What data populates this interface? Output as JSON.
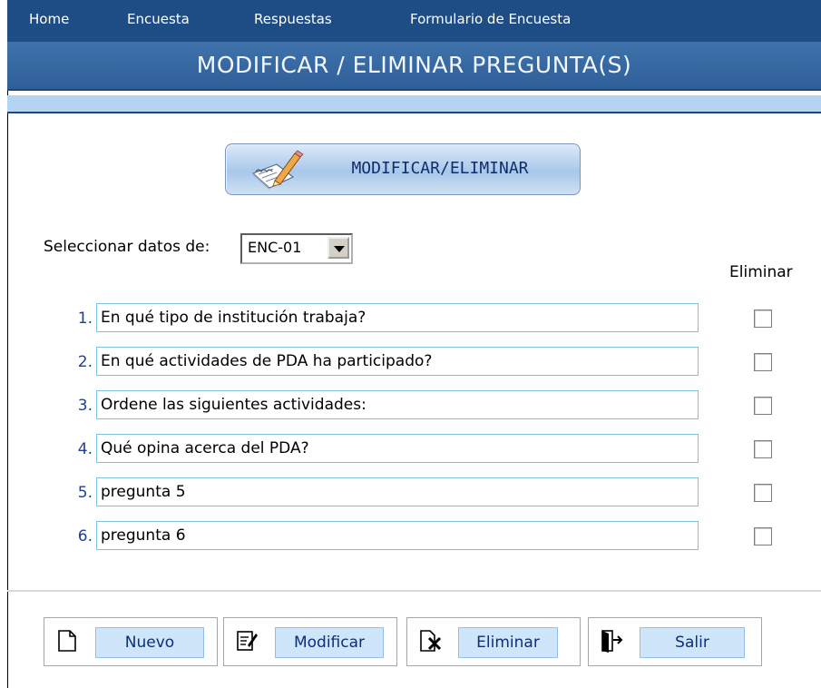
{
  "nav": {
    "home": "Home",
    "encuesta": "Encuesta",
    "respuestas": "Respuestas",
    "formulario": "Formulario de Encuesta"
  },
  "title": "MODIFICAR / ELIMINAR PREGUNTA(S)",
  "action_button": {
    "label": "MODIFICAR/ELIMINAR",
    "icon": "notepad-pencil-icon"
  },
  "selector": {
    "label": "Seleccionar datos de:",
    "value": "ENC-01"
  },
  "eliminar_header": "Eliminar",
  "questions": [
    {
      "number": "1.",
      "text": "En qué tipo de institución trabaja?",
      "eliminar": false
    },
    {
      "number": "2.",
      "text": "En qué actividades de PDA ha participado?",
      "eliminar": false
    },
    {
      "number": "3.",
      "text": "Ordene las siguientes actividades:",
      "eliminar": false
    },
    {
      "number": "4.",
      "text": "Qué opina acerca del PDA?",
      "eliminar": false
    },
    {
      "number": "5.",
      "text": "pregunta 5",
      "eliminar": false
    },
    {
      "number": "6.",
      "text": "pregunta 6",
      "eliminar": false
    }
  ],
  "footer": {
    "nuevo": {
      "label": "Nuevo",
      "icon": "new-document-icon"
    },
    "modificar": {
      "label": "Modificar",
      "icon": "edit-document-icon"
    },
    "eliminar": {
      "label": "Eliminar",
      "icon": "delete-document-icon"
    },
    "salir": {
      "label": "Salir",
      "icon": "exit-door-icon"
    }
  },
  "colors": {
    "nav_bg": "#1e4d86",
    "title_bg": "#3f72ab",
    "stripe": "#b5d3f2",
    "button_bg": "#cfe5fa",
    "number_text": "#1f3f9a"
  }
}
